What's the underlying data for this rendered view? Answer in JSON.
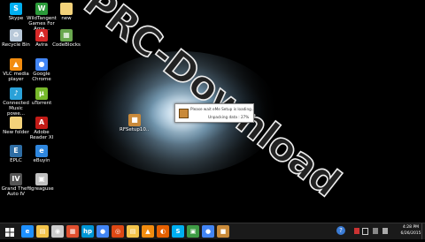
{
  "desktop": {
    "icons": [
      {
        "label": "Skype",
        "color": "#00aff0",
        "glyph": "S",
        "name": "skype-icon"
      },
      {
        "label": "WildTangent Games For Ama...",
        "color": "#2b9a3a",
        "glyph": "W",
        "name": "wildtangent-icon"
      },
      {
        "label": "new",
        "color": "#f3d27a",
        "glyph": "",
        "name": "folder-icon"
      },
      {
        "label": "Recycle Bin",
        "color": "#b8c8d8",
        "glyph": "♻",
        "name": "recycle-bin-icon"
      },
      {
        "label": "Avira",
        "color": "#d62828",
        "glyph": "A",
        "name": "avira-icon"
      },
      {
        "label": "CodeBlocks",
        "color": "#6aa84f",
        "glyph": "▦",
        "name": "codeblocks-icon"
      },
      {
        "label": "VLC media player",
        "color": "#f28c0f",
        "glyph": "▲",
        "name": "vlc-icon"
      },
      {
        "label": "Google Chrome",
        "color": "#4285f4",
        "glyph": "●",
        "name": "chrome-icon"
      },
      {
        "label": "Connected Music powe...",
        "color": "#2aa1d8",
        "glyph": "♪",
        "name": "music-icon"
      },
      {
        "label": "uTorrent",
        "color": "#76b82a",
        "glyph": "µ",
        "name": "utorrent-icon"
      },
      {
        "label": "New folder",
        "color": "#f3d27a",
        "glyph": "",
        "name": "folder-icon"
      },
      {
        "label": "Adobe Reader XI",
        "color": "#c21b17",
        "glyph": "A",
        "name": "adobe-reader-icon"
      },
      {
        "label": "EPLC",
        "color": "#2e6da4",
        "glyph": "E",
        "name": "eplc-icon"
      },
      {
        "label": "eBuyin",
        "color": "#2e86de",
        "glyph": "e",
        "name": "ebuyin-icon"
      },
      {
        "label": "Grand Theft Auto IV",
        "color": "#555555",
        "glyph": "IV",
        "name": "gta-icon"
      },
      {
        "label": "Igreaguse",
        "color": "#c0c0c0",
        "glyph": "▣",
        "name": "app-icon"
      },
      {
        "label": "RFSetup10...",
        "color": "#c98a3a",
        "glyph": "■",
        "name": "setup-icon"
      }
    ],
    "wallpaper_text": "PRC-Download"
  },
  "dialog": {
    "message": "Please wait eMe Setup is loading...",
    "status": "Unpacking data : 27%",
    "progress_percent": 27
  },
  "taskbar": {
    "apps": [
      {
        "name": "ie-icon",
        "color": "#1e90ff",
        "glyph": "e"
      },
      {
        "name": "explorer-icon",
        "color": "#f3c34a",
        "glyph": "▤"
      },
      {
        "name": "media-icon",
        "color": "#cccccc",
        "glyph": "◉"
      },
      {
        "name": "paint-icon",
        "color": "#e04f2f",
        "glyph": "▦"
      },
      {
        "name": "hp-icon",
        "color": "#0096d6",
        "glyph": "hp"
      },
      {
        "name": "chrome-icon",
        "color": "#4285f4",
        "glyph": "●"
      },
      {
        "name": "ubuntu-icon",
        "color": "#dd4814",
        "glyph": "◎"
      },
      {
        "name": "folder-icon",
        "color": "#f3c34a",
        "glyph": "▤"
      },
      {
        "name": "vlc-icon",
        "color": "#f28c0f",
        "glyph": "▲"
      },
      {
        "name": "firefox-icon",
        "color": "#e66000",
        "glyph": "◐"
      },
      {
        "name": "skype-icon",
        "color": "#00aff0",
        "glyph": "S"
      },
      {
        "name": "store-icon",
        "color": "#3e9b45",
        "glyph": "▣"
      },
      {
        "name": "chrome-icon",
        "color": "#4285f4",
        "glyph": "●"
      },
      {
        "name": "setup-icon",
        "color": "#c98a3a",
        "glyph": "■"
      }
    ],
    "tray_icons": [
      "help-icon",
      "flag-icon",
      "battery-icon",
      "network-icon",
      "volume-icon"
    ],
    "time": "4:28 PM",
    "date": "6/26/2015"
  }
}
